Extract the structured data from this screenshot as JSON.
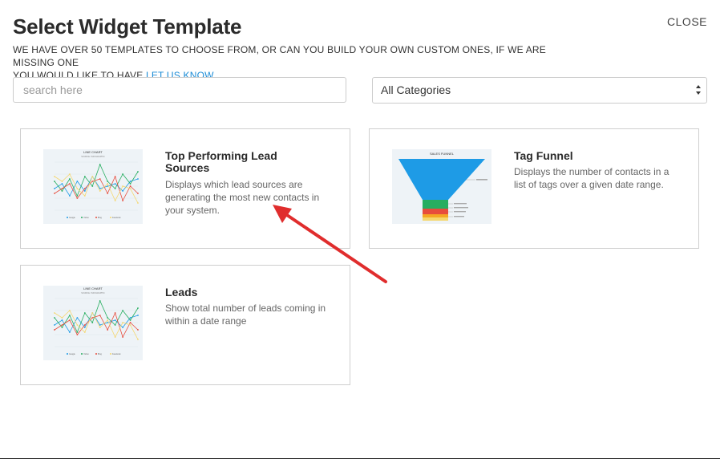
{
  "header": {
    "title": "Select Widget Template",
    "close_label": "CLOSE",
    "subtitle_line1": "WE HAVE OVER 50 TEMPLATES TO CHOOSE FROM, OR CAN YOU BUILD YOUR OWN CUSTOM ONES, IF WE ARE MISSING ONE",
    "subtitle_line2": "YOU WOULD LIKE TO HAVE ",
    "subtitle_link": "LET US KNOW",
    "subtitle_end": "."
  },
  "search": {
    "placeholder": "search here",
    "value": ""
  },
  "category_select": {
    "selected": "All Categories"
  },
  "templates": [
    {
      "title": "Top Performing Lead Sources",
      "description": "Displays which lead sources are generating the most new contacts in your system.",
      "thumb_title": "LINE CHART",
      "thumb_subtitle": "SOURCE: INFOGRAPHIC",
      "legend": [
        "Google",
        "Yahoo",
        "Bing",
        "Facebook"
      ]
    },
    {
      "title": "Tag Funnel",
      "description": "Displays the number of contacts in a list of tags over a given date range.",
      "thumb_title": "SALES FUNNEL"
    },
    {
      "title": "Leads",
      "description": "Show total number of leads coming in within a date range",
      "thumb_title": "LINE CHART",
      "thumb_subtitle": "SOURCE: INFOGRAPHIC",
      "legend": [
        "Google",
        "Yahoo",
        "Bing",
        "Facebook"
      ]
    }
  ],
  "colors": {
    "link": "#1a8bd6",
    "arrow": "#e02d2d",
    "funnel_blue": "#1e9be6",
    "funnel_green": "#27ae60",
    "funnel_red": "#e74c3c",
    "funnel_yellow": "#f5d76e",
    "series": [
      "#1e9be6",
      "#27ae60",
      "#e74c3c",
      "#f5d76e"
    ]
  }
}
